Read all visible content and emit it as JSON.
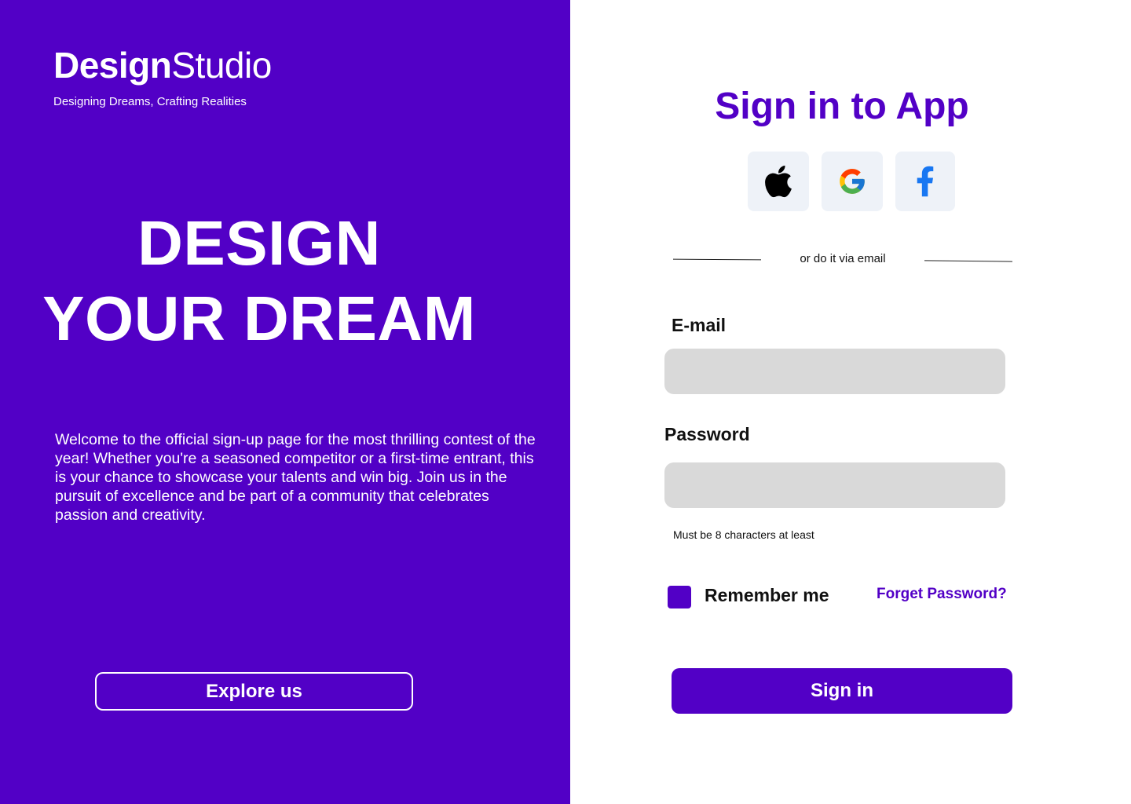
{
  "brand": {
    "name_bold": "Design",
    "name_regular": "Studio",
    "tagline": "Designing Dreams, Crafting Realities"
  },
  "hero": {
    "line1": "DESIGN",
    "line2": "YOUR DREAM"
  },
  "description": "Welcome to the official sign-up page for the most thrilling contest of the year! Whether you're a seasoned competitor or a first-time entrant, this is your chance to showcase your talents and win big. Join us in the pursuit of excellence and be part of a community that celebrates passion and creativity.",
  "explore_label": "Explore us",
  "signin_form": {
    "title": "Sign in to App",
    "social": [
      {
        "name": "apple-icon"
      },
      {
        "name": "google-icon"
      },
      {
        "name": "facebook-icon"
      }
    ],
    "divider_text": "or do it via email",
    "email_label": "E-mail",
    "email_value": "",
    "password_label": "Password",
    "password_value": "",
    "password_hint": "Must be 8 characters at least",
    "remember_label": "Remember me",
    "forgot_label": "Forget Password?",
    "submit_label": "Sign in"
  },
  "colors": {
    "primary": "#5200c6",
    "input_bg": "#d9d9d9",
    "social_bg": "#eef2f8"
  }
}
